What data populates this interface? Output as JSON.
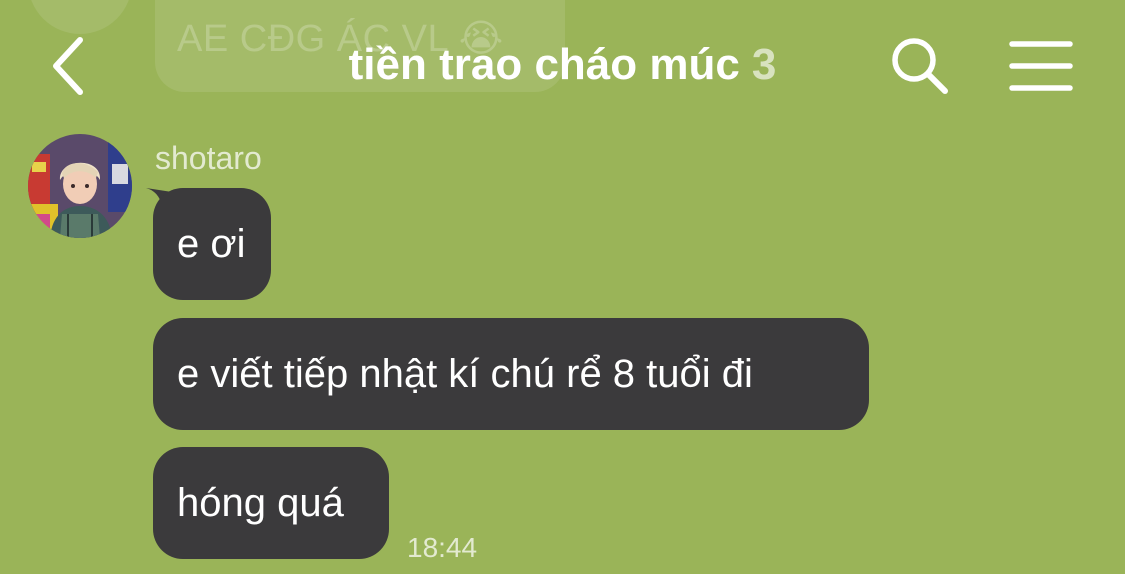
{
  "previous_message": {
    "text": "AE CĐG ÁC VL 😭"
  },
  "header": {
    "title": "tiền trao cháo múc",
    "member_count": "3"
  },
  "colors": {
    "background": "#9ab458",
    "bubble": "#3b3a3c",
    "text": "#ffffff"
  },
  "icons": {
    "back": "chevron-left-icon",
    "search": "search-icon",
    "menu": "hamburger-menu-icon"
  },
  "message_group": {
    "sender": "shotaro",
    "messages": [
      {
        "text": "e ơi"
      },
      {
        "text": "e viết tiếp nhật kí chú rể 8 tuổi đi"
      },
      {
        "text": "hóng quá"
      }
    ],
    "time": "18:44"
  }
}
